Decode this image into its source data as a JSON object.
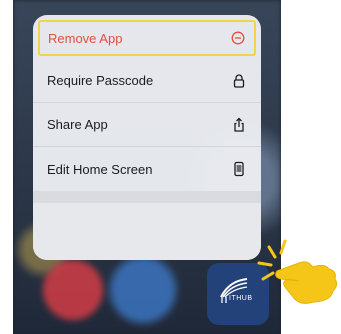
{
  "menu": {
    "items": [
      {
        "label": "Remove App",
        "icon": "minus-circle-icon",
        "color": "#e0503e"
      },
      {
        "label": "Require Passcode",
        "icon": "lock-icon"
      },
      {
        "label": "Share App",
        "icon": "share-icon"
      },
      {
        "label": "Edit Home Screen",
        "icon": "phone-icon"
      }
    ]
  },
  "app": {
    "icon_text": "ITHUB"
  },
  "colors": {
    "highlight": "#f2d449",
    "destructive": "#e0503e",
    "app_icon": "#24427a",
    "hand": "#f5c518"
  }
}
